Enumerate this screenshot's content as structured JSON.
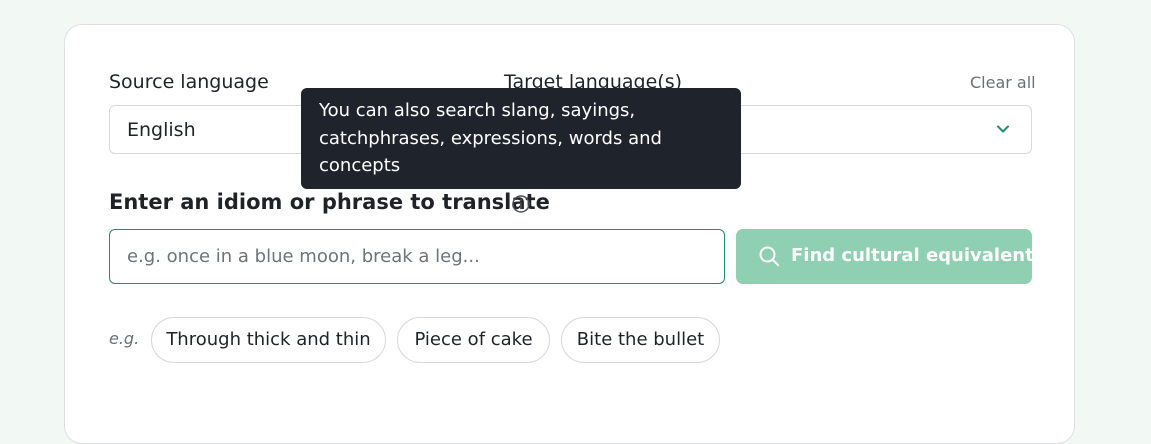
{
  "form": {
    "source_label": "Source language",
    "target_label": "Target language(s)",
    "clear_all": "Clear all",
    "source_value": "English",
    "phrase_label": "Enter an idiom or phrase to translate",
    "input_value": "",
    "input_placeholder": "e.g. once in a blue moon, break a leg...",
    "find_button": "Find cultural equivalent"
  },
  "examples": {
    "prefix": "e.g.",
    "chips": [
      "Through thick and thin",
      "Piece of cake",
      "Bite the bullet"
    ]
  },
  "tooltip": {
    "text": "You can also search slang, sayings, catchphrases, expressions, words and concepts"
  },
  "icons": {
    "info": "info-icon",
    "search": "search-icon",
    "chevron": "chevron-down-icon"
  },
  "colors": {
    "page_bg": "#f2f8f4",
    "accent": "#1f8f6e",
    "button_disabled": "#8fcfb2",
    "tooltip_bg": "#1f232b"
  }
}
